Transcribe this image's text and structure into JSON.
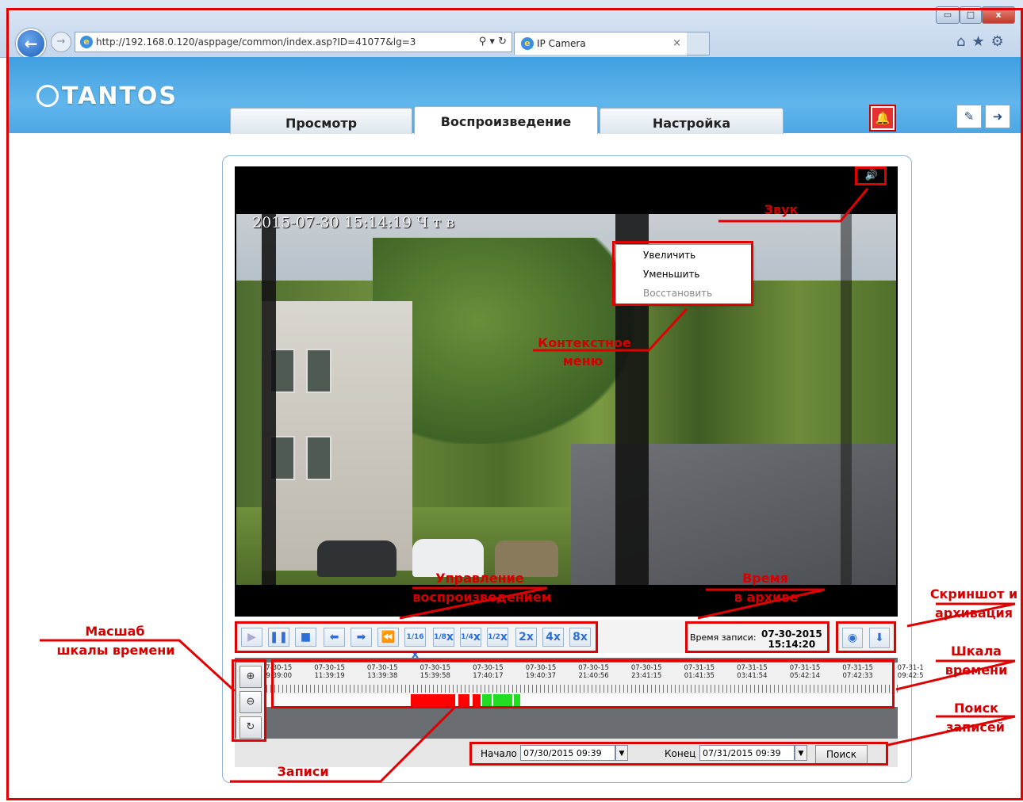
{
  "browser": {
    "url": "http://192.168.0.120/asppage/common/index.asp?ID=41077&lg=3",
    "tab_title": "IP Camera",
    "tab_close": "×",
    "win_min": "▭",
    "win_max": "□",
    "win_close": "x",
    "icons": [
      "home-icon",
      "star-icon",
      "gear-icon"
    ]
  },
  "app": {
    "logo_text": "TANTOS",
    "tabs": [
      {
        "label": "Просмотр",
        "active": false
      },
      {
        "label": "Воспроизведение",
        "active": true
      },
      {
        "label": "Настройка",
        "active": false
      }
    ]
  },
  "video": {
    "osd": "2015-07-30 15:14:19 Ч т в",
    "context_menu": [
      "Увеличить",
      "Уменьшить",
      "Восстановить"
    ]
  },
  "controls": {
    "speed_labels": [
      "2x",
      "4x",
      "8x"
    ],
    "fractions": [
      "1/16",
      "1/8",
      "1/4",
      "1/2"
    ],
    "rec_time_label": "Время записи:",
    "rec_date": "07-30-2015",
    "rec_time": "15:14:20"
  },
  "timeline": {
    "ticks": [
      [
        "07-30-15",
        "09:39:00"
      ],
      [
        "07-30-15",
        "11:39:19"
      ],
      [
        "07-30-15",
        "13:39:38"
      ],
      [
        "07-30-15",
        "15:39:58"
      ],
      [
        "07-30-15",
        "17:40:17"
      ],
      [
        "07-30-15",
        "19:40:37"
      ],
      [
        "07-30-15",
        "21:40:56"
      ],
      [
        "07-30-15",
        "23:41:15"
      ],
      [
        "07-31-15",
        "01:41:35"
      ],
      [
        "07-31-15",
        "03:41:54"
      ],
      [
        "07-31-15",
        "05:42:14"
      ],
      [
        "07-31-15",
        "07:42:33"
      ],
      [
        "07-31-1",
        "09:42:5"
      ]
    ],
    "zoom_in_label": "x2",
    "zoom_out_label": "1/2"
  },
  "search": {
    "start_label": "Начало",
    "start_value": "07/30/2015 09:39",
    "end_label": "Конец",
    "end_value": "07/31/2015 09:39",
    "button": "Поиск"
  },
  "annotations": {
    "sound": "Звук",
    "context_menu_1": "Контекстное",
    "context_menu_2": "меню",
    "playback_1": "Управление",
    "playback_2": "воспроизведением",
    "archive_time_1": "Время",
    "archive_time_2": "в архиве",
    "screenshot_1": "Скриншот и",
    "screenshot_2": "архивация",
    "scale_1": "Масшаб",
    "scale_2": "шкалы времени",
    "timeline_1": "Шкала",
    "timeline_2": "времени",
    "search_1": "Поиск",
    "search_2": "записей",
    "records": "Записи"
  },
  "colors": {
    "annotation": "#e00000",
    "header_blue": "#4ca7e4",
    "record_red": "#ff0000",
    "record_green": "#22dd22"
  }
}
